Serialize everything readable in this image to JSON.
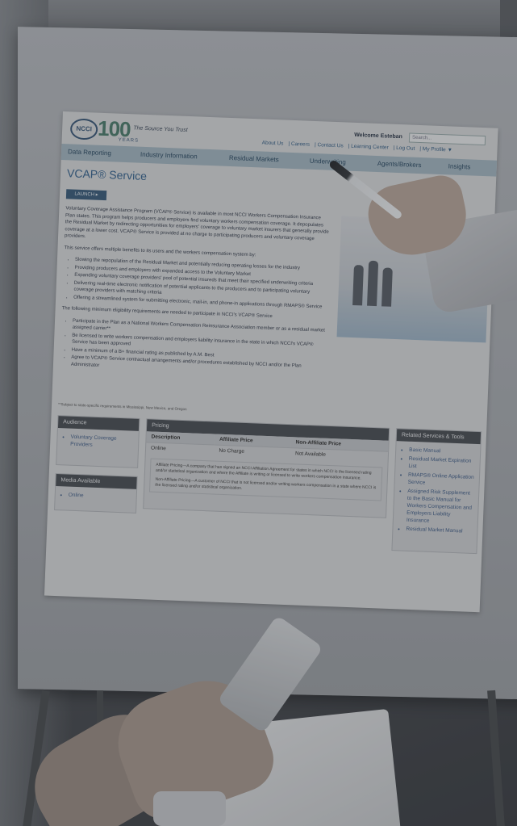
{
  "site": {
    "logo_text": "NCCI",
    "logo_number": "100",
    "logo_years": "YEARS",
    "tagline": "The Source You Trust",
    "welcome": "Welcome Esteban",
    "search_placeholder": "Search...",
    "top_links": [
      "About Us",
      "Careers",
      "Contact Us",
      "Learning Center",
      "Log Out",
      "My Profile ▼"
    ],
    "nav": [
      "Data Reporting",
      "Industry Information",
      "Residual Markets",
      "Underwriting",
      "Agents/Brokers",
      "Insights"
    ]
  },
  "page": {
    "title": "VCAP® Service",
    "launch_label": "LAUNCH ▸",
    "intro": "Voluntary Coverage Assistance Program (VCAP® Service) is available in most NCCI Workers Compensation Insurance Plan states. This program helps producers and employers find voluntary workers compensation coverage. It depopulates the Residual Market by redirecting opportunities for employers' coverage to voluntary market insurers that generally provide coverage at a lower cost. VCAP® Service is provided at no charge to participating producers and voluntary coverage providers.",
    "benefits_intro": "This service offers multiple benefits to its users and the workers compensation system by:",
    "benefits": [
      "Slowing the repopulation of the Residual Market and potentially reducing operating losses for the industry",
      "Providing producers and employers with expanded access to the Voluntary Market",
      "Expanding voluntary coverage providers' pool of potential insureds that meet their specified underwriting criteria",
      "Delivering real-time electronic notification of potential applicants to the producers and to participating voluntary coverage providers with matching criteria",
      "Offering a streamlined system for submitting electronic, mail-in, and phone-in applications through RMAPS® Service"
    ],
    "requirements_intro": "The following minimum eligibility requirements are needed to participate in NCCI's VCAP® Service",
    "requirements": [
      "Participate in the Plan as a National Workers Compensation Reinsurance Association member or as a residual market assigned carrier**",
      "Be licensed to write workers compensation and employers liability insurance in the state in which NCCI's VCAP® Service has been approved",
      "Have a minimum of a B+ financial rating as published by A.M. Best",
      "Agree to VCAP® Service contractual arrangements and/or procedures established by NCCI and/or the Plan Administrator"
    ],
    "footnote": "**Subject to state-specific requirements in Mississippi, New Mexico, and Oregon"
  },
  "audience": {
    "heading": "Audience",
    "items": [
      "Voluntary Coverage Providers"
    ]
  },
  "media": {
    "heading": "Media Available",
    "items": [
      "Online"
    ]
  },
  "pricing": {
    "heading": "Pricing",
    "columns": [
      "Description",
      "Affiliate Price",
      "Non-Affiliate Price"
    ],
    "rows": [
      [
        "Online",
        "No Charge",
        "Not Available"
      ]
    ],
    "affiliate_note": "Affiliate Pricing—A company that has signed an NCCI Affiliation Agreement for states in which NCCI is the licensed rating and/or statistical organization and where the Affiliate is writing or licensed to write workers compensation insurance.",
    "nonaffiliate_note": "Non-Affiliate Pricing—A customer of NCCI that is not licensed and/or writing workers compensation in a state where NCCI is the licensed rating and/or statistical organization."
  },
  "related": {
    "heading": "Related Services & Tools",
    "items": [
      "Basic Manual",
      "Residual Market Expiration List",
      "RMAPS® Online Application Service",
      "Assigned Risk Supplement to the Basic Manual for Workers Compensation and Employers Liability Insurance",
      "Residual Market Manual"
    ]
  }
}
